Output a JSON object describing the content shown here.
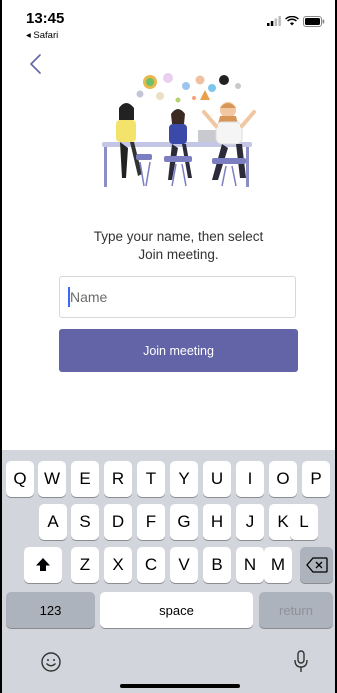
{
  "status": {
    "time": "13:45",
    "back_app": "◂ Safari"
  },
  "nav": {
    "back_icon": "chevron-left-icon"
  },
  "illustration": {
    "name": "people-meeting-illustration"
  },
  "prompt": {
    "line1": "Type your name, then select",
    "line2": "Join meeting."
  },
  "name_input": {
    "value": "",
    "placeholder": "Name"
  },
  "join": {
    "label": "Join meeting"
  },
  "colors": {
    "accent": "#6264a7",
    "keyboard_bg": "#d2d5db"
  },
  "keyboard": {
    "row1": [
      "Q",
      "W",
      "E",
      "R",
      "T",
      "Y",
      "U",
      "I",
      "O",
      "P"
    ],
    "row2": [
      "A",
      "S",
      "D",
      "F",
      "G",
      "H",
      "J",
      "K",
      "L"
    ],
    "row3": [
      "Z",
      "X",
      "C",
      "V",
      "B",
      "N",
      "M"
    ],
    "numbers_label": "123",
    "space_label": "space",
    "return_label": "return"
  }
}
